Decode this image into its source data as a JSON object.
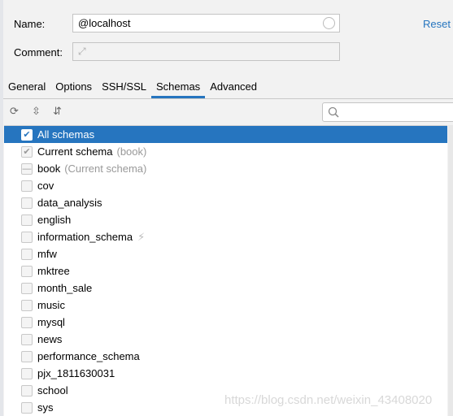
{
  "form": {
    "name_label": "Name:",
    "name_value": "@localhost",
    "comment_label": "Comment:",
    "comment_value": "",
    "reset": "Reset"
  },
  "tabs": [
    "General",
    "Options",
    "SSH/SSL",
    "Schemas",
    "Advanced"
  ],
  "active_tab": "Schemas",
  "toolbar": {
    "icons": [
      "refresh-icon",
      "expand-all-icon",
      "collapse-all-icon"
    ],
    "search_placeholder": ""
  },
  "schemas": [
    {
      "label": "All schemas",
      "state": "checked",
      "selected": true
    },
    {
      "label": "Current schema",
      "hint": "(book)",
      "state": "checked-disabled"
    },
    {
      "label": "book",
      "hint": "(Current schema)",
      "state": "indeterminate"
    },
    {
      "label": "cov",
      "state": "unchecked"
    },
    {
      "label": "data_analysis",
      "state": "unchecked"
    },
    {
      "label": "english",
      "state": "unchecked"
    },
    {
      "label": "information_schema",
      "state": "unchecked",
      "icon": "lightning-icon"
    },
    {
      "label": "mfw",
      "state": "unchecked"
    },
    {
      "label": "mktree",
      "state": "unchecked"
    },
    {
      "label": "month_sale",
      "state": "unchecked"
    },
    {
      "label": "music",
      "state": "unchecked"
    },
    {
      "label": "mysql",
      "state": "unchecked"
    },
    {
      "label": "news",
      "state": "unchecked"
    },
    {
      "label": "performance_schema",
      "state": "unchecked"
    },
    {
      "label": "pjx_1811630031",
      "state": "unchecked"
    },
    {
      "label": "school",
      "state": "unchecked"
    },
    {
      "label": "sys",
      "state": "unchecked"
    }
  ],
  "watermark": "https://blog.csdn.net/weixin_43408020",
  "colors": {
    "accent": "#2675bf"
  }
}
